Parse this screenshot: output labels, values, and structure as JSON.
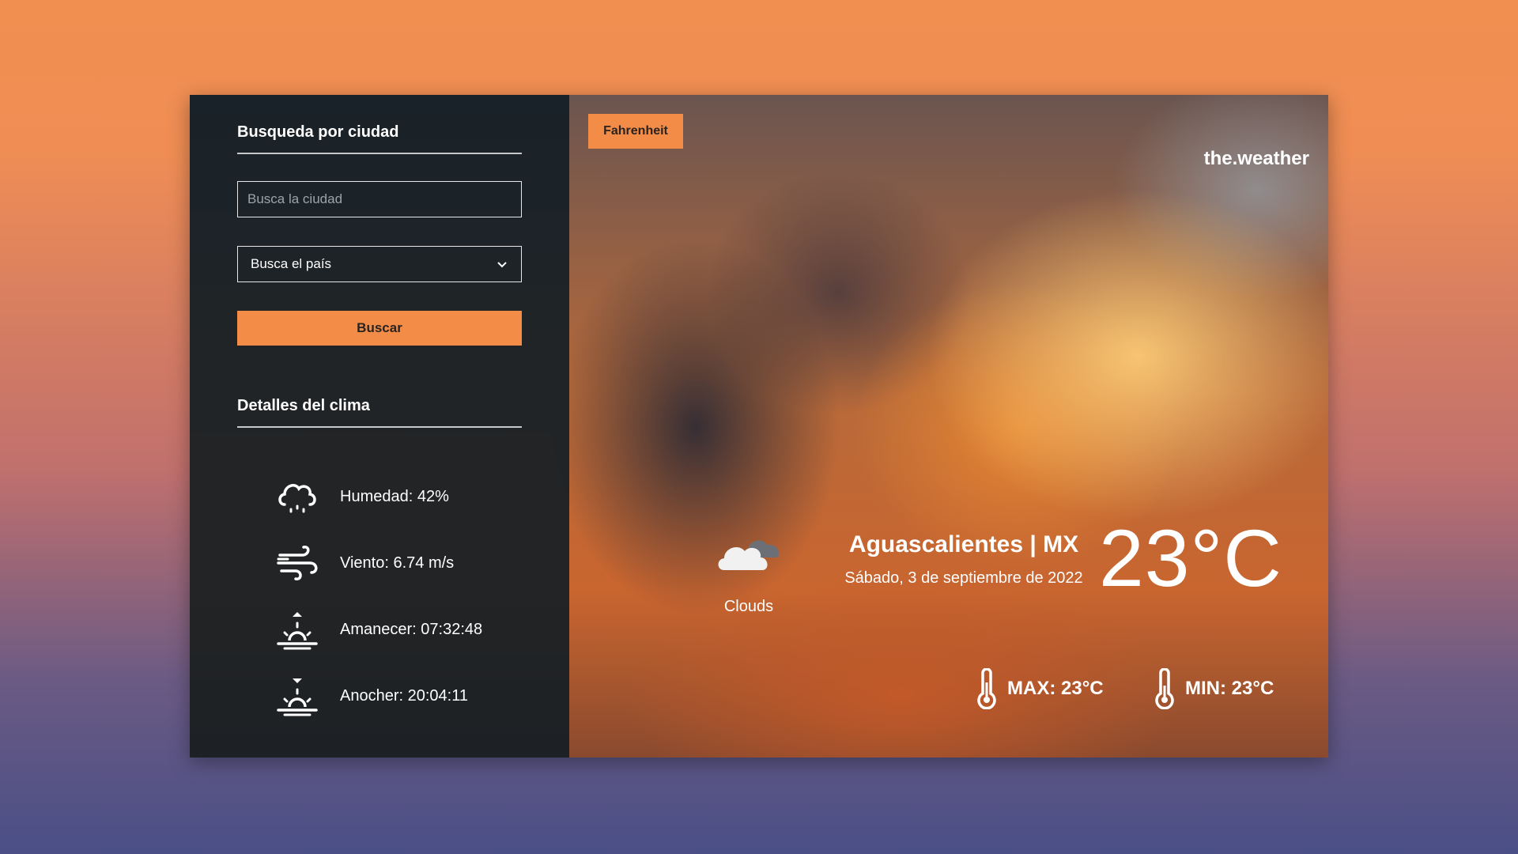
{
  "search": {
    "section_title": "Busqueda por ciudad",
    "city_placeholder": "Busca la ciudad",
    "country_select": "Busca el país",
    "button_label": "Buscar"
  },
  "details": {
    "section_title": "Detalles del clima",
    "items": [
      {
        "icon": "humidity-cloud-icon",
        "text": "Humedad: 42%"
      },
      {
        "icon": "wind-icon",
        "text": "Viento: 6.74 m/s"
      },
      {
        "icon": "sunrise-icon",
        "text": "Amanecer: 07:32:48"
      },
      {
        "icon": "sunset-icon",
        "text": "Anocher: 20:04:11"
      }
    ]
  },
  "main": {
    "unit_toggle": "Fahrenheit",
    "brand": "the.weather",
    "condition_icon": "clouds-icon",
    "condition": "Clouds",
    "city": "Aguascalientes | MX",
    "date": "Sábado, 3 de septiembre de 2022",
    "temperature": "23°C",
    "max": "MAX: 23°C",
    "min": "MIN: 23°C"
  },
  "colors": {
    "accent": "#f28c46",
    "sidebar": "#111d25"
  }
}
